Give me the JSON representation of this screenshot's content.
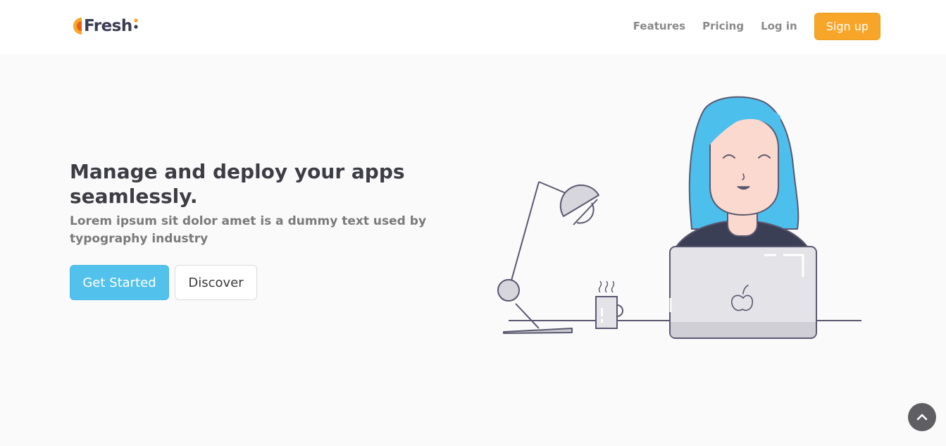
{
  "navbar": {
    "brand": "Fresh",
    "links": [
      "Features",
      "Pricing",
      "Log in"
    ],
    "signup_label": "Sign up"
  },
  "hero": {
    "title": "Manage and deploy your apps seamlessly.",
    "subtitle": "Lorem ipsum sit dolor amet is a dummy text used by typography industry",
    "primary_button": "Get Started",
    "secondary_button": "Discover"
  },
  "colors": {
    "accent_orange": "#f7a62a",
    "primary_blue": "#52c1ec",
    "hair_blue": "#4dbfec",
    "heading": "#3d3d45",
    "muted_text": "#7a7a7a",
    "hero_background": "#fafafa"
  },
  "icons": {
    "logo": "fresh-logo-icon",
    "back_to_top": "chevron-up-icon"
  }
}
